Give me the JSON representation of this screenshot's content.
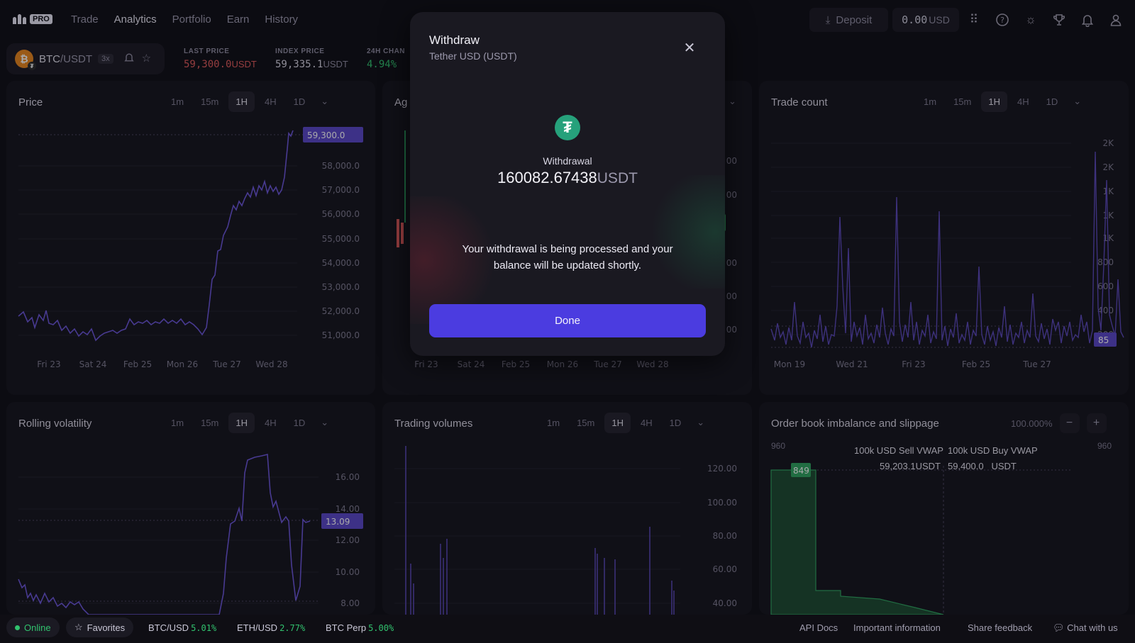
{
  "header": {
    "logo_badge": "PRO",
    "nav": [
      "Trade",
      "Analytics",
      "Portfolio",
      "Earn",
      "History"
    ],
    "active_nav": "Analytics",
    "deposit_label": "Deposit",
    "balance_value": "0.00",
    "balance_unit": "USD",
    "icons": [
      "apps-grid-icon",
      "help-icon",
      "theme-sun-icon",
      "trophy-icon",
      "bell-icon",
      "user-icon"
    ]
  },
  "market": {
    "pair_base": "BTC",
    "pair_quote": "/USDT",
    "leverage": "3x",
    "last_price_label": "LAST PRICE",
    "last_price_value": "59,300.0",
    "last_price_unit": "USDT",
    "index_price_label": "INDEX PRICE",
    "index_price_value": "59,335.1",
    "index_price_unit": "USDT",
    "change_label": "24H CHAN",
    "change_value": "4.94%"
  },
  "timeframes": [
    "1m",
    "15m",
    "1H",
    "4H",
    "1D"
  ],
  "active_timeframe": "1H",
  "panels": {
    "price": {
      "title": "Price",
      "y_ticks": [
        "58,000.0",
        "57,000.0",
        "56,000.0",
        "55,000.0",
        "54,000.0",
        "53,000.0",
        "52,000.0",
        "51,000.0"
      ],
      "x_ticks": [
        "Fri 23",
        "Sat 24",
        "Feb 25",
        "Mon 26",
        "Tue 27",
        "Wed 28"
      ],
      "current_tag": "59,300.0"
    },
    "aggregated": {
      "title": "Ag",
      "x_ticks": [
        "Fri 23",
        "Sat 24",
        "Feb 25",
        "Mon 26",
        "Tue 27",
        "Wed 28"
      ],
      "y_ticks": [
        "00",
        "00",
        "00",
        "00",
        "00"
      ]
    },
    "trade_count": {
      "title": "Trade count",
      "y_ticks": [
        "2K",
        "2K",
        "1K",
        "1K",
        "1K",
        "800",
        "600",
        "400",
        "200"
      ],
      "x_ticks": [
        "Mon 19",
        "Wed 21",
        "Fri 23",
        "Feb 25",
        "Tue 27"
      ],
      "current_tag": "85"
    },
    "volatility": {
      "title": "Rolling volatility",
      "y_ticks": [
        "16.00",
        "14.00",
        "12.00",
        "10.00",
        "8.00"
      ],
      "current_tag": "13.09"
    },
    "volumes": {
      "title": "Trading volumes",
      "y_ticks": [
        "120.00",
        "100.00",
        "80.00",
        "60.00",
        "40.00"
      ]
    },
    "orderbook": {
      "title": "Order book imbalance and slippage",
      "percent": "100.000%",
      "axis_left": "960",
      "axis_right": "960",
      "sell_label": "100k USD Sell VWAP",
      "buy_label": "100k USD Buy VWAP",
      "sell_value": "59,203.1USDT",
      "buy_value": "59,400.0",
      "buy_unit": "USDT",
      "tag": "849"
    }
  },
  "modal": {
    "title": "Withdraw",
    "subtitle": "Tether USD (USDT)",
    "icon_glyph": "₮",
    "label": "Withdrawal",
    "amount": "160082.67438",
    "currency": "USDT",
    "message": "Your withdrawal is being processed and your balance will be updated shortly.",
    "done_label": "Done"
  },
  "footer": {
    "status": "Online",
    "favorites": "Favorites",
    "tickers": [
      {
        "name": "BTC/USD",
        "change": "5.01%"
      },
      {
        "name": "ETH/USD",
        "change": "2.77%"
      },
      {
        "name": "BTC Perp",
        "change": "5.00%"
      }
    ],
    "links": [
      "API Docs",
      "Important information",
      "Share feedback",
      "Chat with us"
    ]
  },
  "colors": {
    "background": "#0f0e14",
    "panel": "#15141c",
    "accent": "#4b3ce0",
    "line": "#6a55d8",
    "positive": "#31c26e",
    "negative": "#e05a5a"
  }
}
